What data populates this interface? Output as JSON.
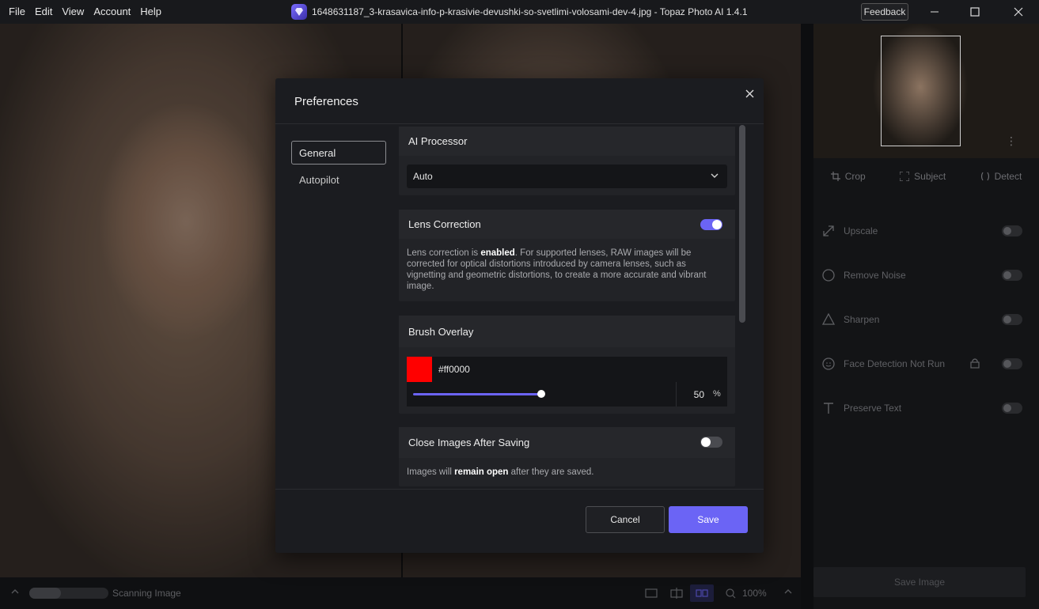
{
  "menu": [
    "File",
    "Edit",
    "View",
    "Account",
    "Help"
  ],
  "window": {
    "title": "1648631187_3-krasavica-info-p-krasivie-devushki-so-svetlimi-volosami-dev-4.jpg - Topaz Photo AI 1.4.1",
    "feedback_label": "Feedback"
  },
  "side_panel": {
    "tools": [
      "Crop",
      "Subject",
      "Detect"
    ],
    "filters": [
      {
        "label": "Upscale",
        "icon": "upscale-icon"
      },
      {
        "label": "Remove Noise",
        "icon": "remove-noise-icon"
      },
      {
        "label": "Sharpen",
        "icon": "sharpen-icon"
      },
      {
        "label": "Face Detection Not Run",
        "icon": "face-icon",
        "locked": true
      },
      {
        "label": "Preserve Text",
        "icon": "text-icon"
      }
    ],
    "save_image_label": "Save Image"
  },
  "status_bar": {
    "scan_label": "Scanning Image",
    "scan_progress": 0.4,
    "zoom": "100%"
  },
  "preferences": {
    "title": "Preferences",
    "nav": {
      "general": "General",
      "autopilot": "Autopilot"
    },
    "ai_processor": {
      "heading": "AI Processor",
      "value": "Auto"
    },
    "lens_correction": {
      "heading": "Lens Correction",
      "enabled": true,
      "desc_1": "Lens correction is ",
      "desc_bold": "enabled",
      "desc_2": ". For supported lenses, RAW images will be corrected for optical distortions introduced by camera lenses, such as vignetting and geometric distortions, to create a more accurate and vibrant image."
    },
    "brush_overlay": {
      "heading": "Brush Overlay",
      "color_hex": "#ff0000",
      "opacity_value": "50",
      "opacity_unit": "%",
      "opacity_fraction": 0.5
    },
    "close_after_saving": {
      "heading": "Close Images After Saving",
      "enabled": false,
      "desc_1": "Images will ",
      "desc_bold": "remain open",
      "desc_2": " after they are saved."
    },
    "cancel_label": "Cancel",
    "save_label": "Save"
  },
  "colors": {
    "accent": "#6b64f5",
    "brush_color": "#ff0000"
  }
}
